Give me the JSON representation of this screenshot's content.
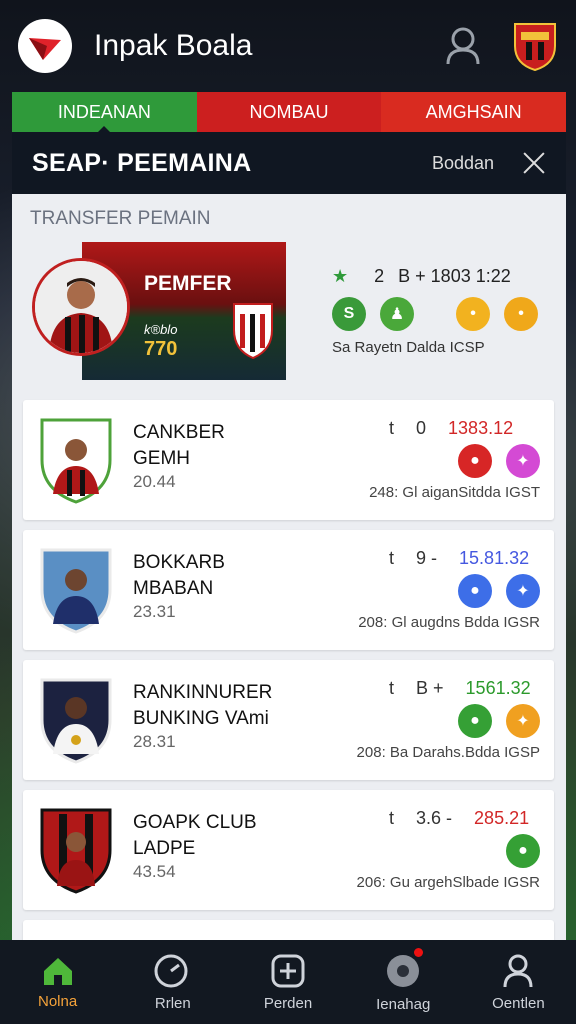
{
  "app": {
    "title": "Inpak Boala"
  },
  "tabs": [
    {
      "label": "INDEANAN"
    },
    {
      "label": "NOMBAU"
    },
    {
      "label": "AMGHSAIN"
    }
  ],
  "panel": {
    "title": "SEAP· PEEMAINA",
    "action": "Boddan"
  },
  "section": {
    "label": "TRANSFER PEMAIN"
  },
  "featured": {
    "name": "PEMFER",
    "sub": "k®blo",
    "value": "770",
    "star": "★",
    "count": "2",
    "odds": "B + 1803 1:22",
    "caption": "Sa Rayetn Dalda ICSP",
    "badges": [
      "S",
      "♟",
      "•",
      "•"
    ]
  },
  "players": [
    {
      "name": "CANKBER GEMH",
      "age": "20.44",
      "s1": "t",
      "s2": "0",
      "price": "1383.12",
      "price_color": "#d22727",
      "footer": "248: Gl aiganSitdda IGST",
      "badge_colors": [
        "#d72626",
        "#d44ad4"
      ]
    },
    {
      "name": "BOKKARB MBABAN",
      "age": "23.31",
      "s1": "t",
      "s2": "9 -",
      "price": "15.81.32",
      "price_color": "#4558e0",
      "footer": "208: Gl augdns Bdda IGSR",
      "badge_colors": [
        "#3d6ee8",
        "#3d6ee8"
      ]
    },
    {
      "name": "RANKINNURER BUNKING VAmi",
      "age": "28.31",
      "s1": "t",
      "s2": "B +",
      "price": "1561.32",
      "price_color": "#2c9a2c",
      "footer": "208: Ba Darahs.Bdda IGSP",
      "badge_colors": [
        "#35a035",
        "#f0a020"
      ]
    },
    {
      "name": "GOAPK CLUB LADPE",
      "age": "43.54",
      "s1": "t",
      "s2": "3.6 -",
      "price": "285.21",
      "price_color": "#d22727",
      "footer": "206: Gu argehSlbade IGSR",
      "badge_colors": [
        "#35a035"
      ]
    }
  ],
  "nav": [
    {
      "label": "Nolna"
    },
    {
      "label": "Rrlen"
    },
    {
      "label": "Perden"
    },
    {
      "label": "Ienahag"
    },
    {
      "label": "Oentlen"
    }
  ]
}
